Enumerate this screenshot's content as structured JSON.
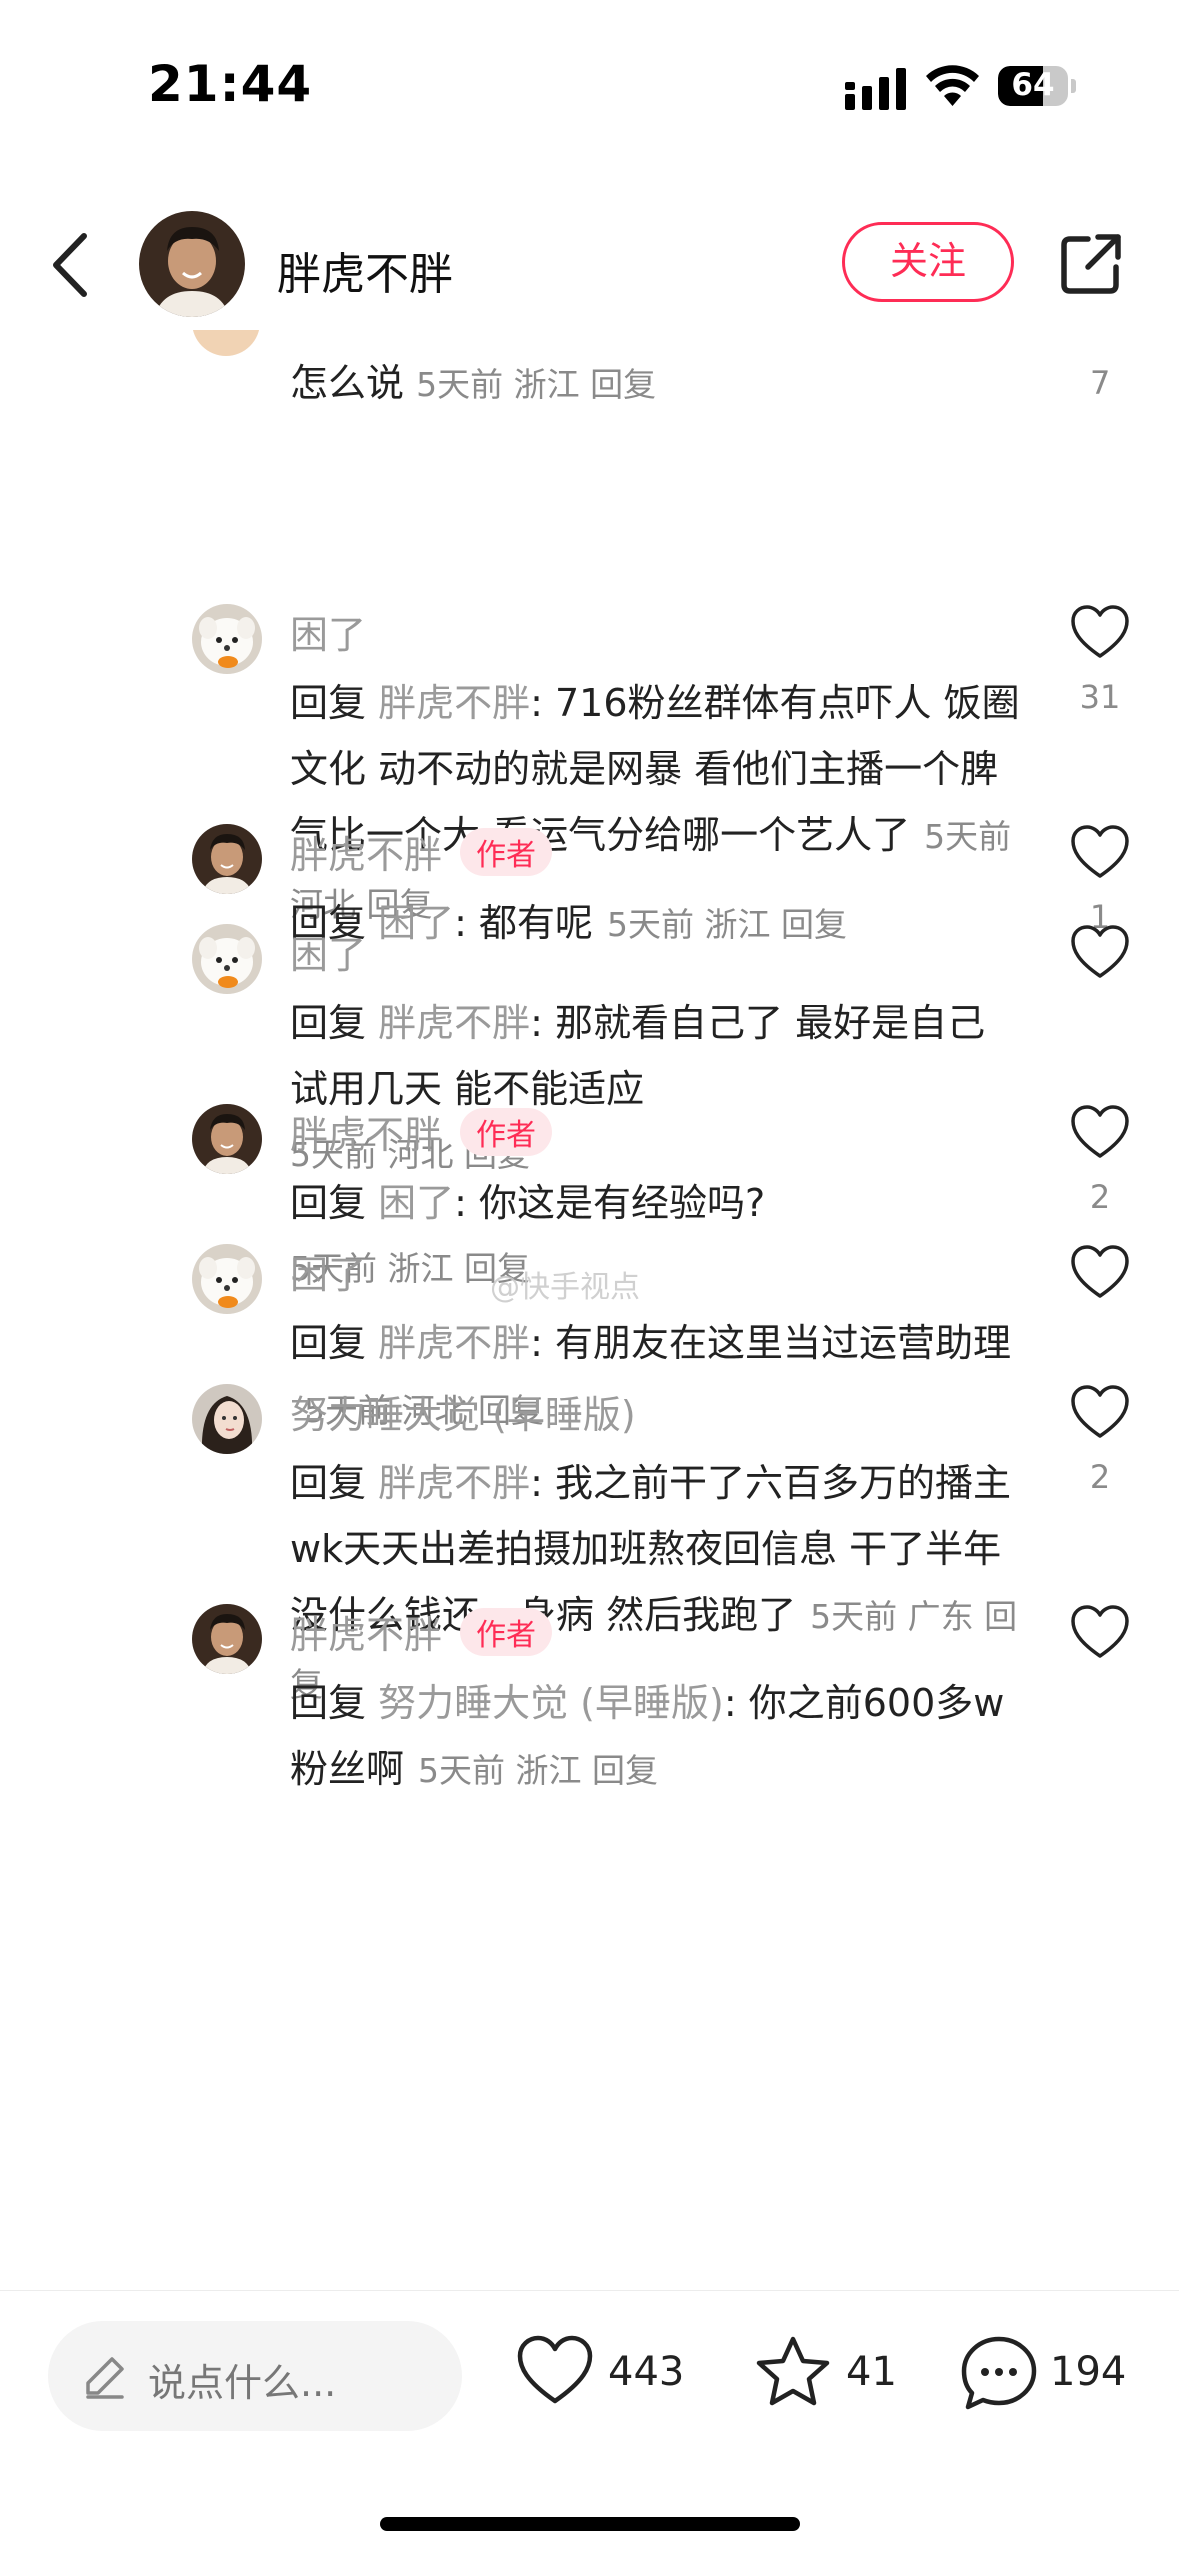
{
  "status_bar": {
    "time": "21:44",
    "battery": "64",
    "battery_level": 0.64
  },
  "header": {
    "title": "胖虎不胖",
    "follow_label": "关注"
  },
  "partial_comment": {
    "text": "怎么说",
    "meta": "5天前 浙江 回复",
    "likes": "7"
  },
  "comments": [
    {
      "name": "困了",
      "is_author": false,
      "reply_prefix": "回复 ",
      "reply_to": "胖虎不胖",
      "text": ": 716粉丝群体有点吓人 饭圈文化  动不动的就是网暴 看他们主播一个脾气比一个大 看运气分给哪一个艺人了",
      "meta": "5天前 河北 回复",
      "likes": "31",
      "avatar": "dog-avatar"
    },
    {
      "name": "胖虎不胖",
      "is_author": true,
      "author_badge": "作者",
      "reply_prefix": "回复 ",
      "reply_to": "困了",
      "text": ": 都有呢",
      "meta": "5天前 浙江 回复",
      "likes": "1",
      "avatar": "man-avatar"
    },
    {
      "name": "困了",
      "is_author": false,
      "reply_prefix": "回复 ",
      "reply_to": "胖虎不胖",
      "text": ": 那就看自己了 最好是自己试用几天 能不能适应",
      "meta": "5天前 河北 回复",
      "likes": "",
      "avatar": "dog-avatar"
    },
    {
      "name": "胖虎不胖",
      "is_author": true,
      "author_badge": "作者",
      "reply_prefix": "回复 ",
      "reply_to": "困了",
      "text": ": 你这是有经验吗?",
      "meta": "5天前 浙江 回复",
      "likes": "2",
      "avatar": "man-avatar"
    },
    {
      "name": "困了",
      "is_author": false,
      "reply_prefix": "回复 ",
      "reply_to": "胖虎不胖",
      "text": ": 有朋友在这里当过运营助理",
      "meta": "5天前 河北 回复",
      "likes": "",
      "avatar": "dog-avatar"
    },
    {
      "name": "努力睡大觉 (早睡版)",
      "is_author": false,
      "reply_prefix": "回复 ",
      "reply_to": "胖虎不胖",
      "text": ": 我之前干了六百多万的播主 wk天天出差拍摄加班熬夜回信息 干了半年没什么钱还一身病 然后我跑了",
      "meta": "5天前 广东 回复",
      "likes": "2",
      "avatar": "girl-avatar"
    },
    {
      "name": "胖虎不胖",
      "is_author": true,
      "author_badge": "作者",
      "reply_prefix": "回复 ",
      "reply_to": "努力睡大觉 (早睡版)",
      "text": ": 你之前600多w粉丝啊",
      "meta": "5天前 浙江 回复",
      "likes": "",
      "avatar": "man-avatar"
    }
  ],
  "watermark": "@快手视点",
  "bottom_bar": {
    "placeholder": "说点什么...",
    "likes": "443",
    "favorites": "41",
    "comments": "194"
  }
}
